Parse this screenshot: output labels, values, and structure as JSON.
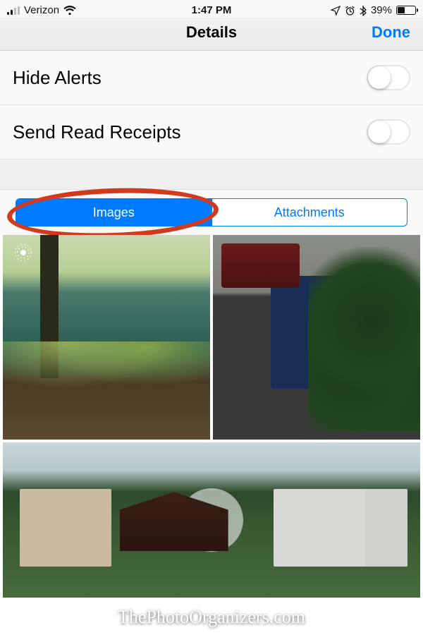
{
  "statusbar": {
    "carrier": "Verizon",
    "time": "1:47 PM",
    "battery_pct": "39%"
  },
  "navbar": {
    "title": "Details",
    "done": "Done"
  },
  "settings": {
    "hide_alerts": "Hide Alerts",
    "read_receipts": "Send Read Receipts"
  },
  "segmented": {
    "images": "Images",
    "attachments": "Attachments"
  },
  "watermark": "ThePhotoOrganizers.com"
}
